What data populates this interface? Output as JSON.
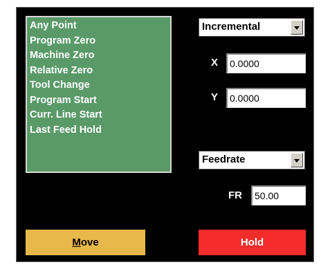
{
  "points": [
    "Any Point",
    "Program Zero",
    "Machine Zero",
    "Relative Zero",
    "Tool Change",
    "Program Start",
    "Curr. Line Start",
    "Last Feed Hold"
  ],
  "mode_select": {
    "value": "Incremental"
  },
  "x": {
    "label": "X",
    "value": "0.0000"
  },
  "y": {
    "label": "Y",
    "value": "0.0000"
  },
  "feed_select": {
    "value": "Feedrate"
  },
  "fr": {
    "label": "FR",
    "value": "50.00"
  },
  "buttons": {
    "move_first": "M",
    "move_rest": "ove",
    "hold": "Hold"
  },
  "colors": {
    "panel_bg": "#000000",
    "list_bg": "#5a9a68",
    "move_btn": "#e7b84a",
    "hold_btn": "#f42c2c"
  }
}
